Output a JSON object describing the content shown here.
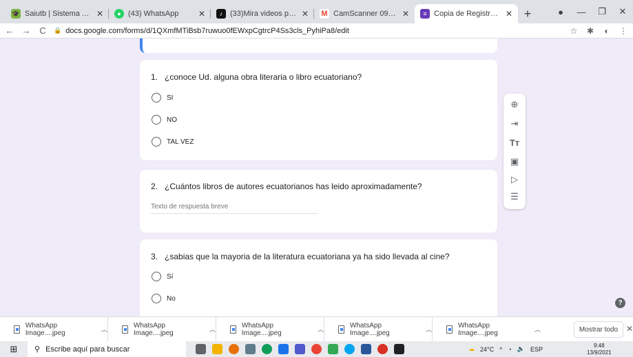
{
  "browser": {
    "tabs": [
      {
        "title": "Saiutb | Sistema Académico |",
        "icon_color": "#7cb342",
        "icon": "graduation-cap-icon"
      },
      {
        "title": "(43) WhatsApp",
        "icon_color": "#25d366",
        "icon": "whatsapp-icon"
      },
      {
        "title": "(33)Mira videos populares se",
        "icon_color": "#111111",
        "icon": "tiktok-icon"
      },
      {
        "title": "CamScanner 09-02-2021 05.",
        "icon_color": "#ea4335",
        "icon": "gmail-icon"
      },
      {
        "title": "Copia de Registro para la obr",
        "icon_color": "#673ab7",
        "icon": "forms-icon"
      }
    ],
    "url": "docs.google.com/forms/d/1QXmfMTiBsb7ruwuo0fEWxpCgtrcP4Ss3cls_PyhiPa8/edit"
  },
  "form": {
    "questions": [
      {
        "number": "1.",
        "text": "¿conoce Ud. alguna obra literaria o libro ecuatoriano?",
        "options": [
          "SI",
          "NO",
          "TAL VEZ"
        ]
      },
      {
        "number": "2.",
        "text": "¿Cuántos libros de autores ecuatorianos has leido aproximadamente?",
        "placeholder": "Texto de respuesta breve"
      },
      {
        "number": "3.",
        "text": "¿sabias que la mayoria de la literatura ecuatoriana ya ha sido llevada al cine?",
        "options": [
          "Sí",
          "No"
        ]
      }
    ]
  },
  "downloads": {
    "items": [
      "WhatsApp Image....jpeg",
      "WhatsApp Image....jpeg",
      "WhatsApp Image....jpeg",
      "WhatsApp Image....jpeg",
      "WhatsApp Image....jpeg"
    ],
    "show_all": "Mostrar todo"
  },
  "taskbar": {
    "search_placeholder": "Escribe aquí para buscar",
    "temperature": "24°C",
    "language": "ESP",
    "time": "9:48",
    "date": "13/9/2021"
  }
}
